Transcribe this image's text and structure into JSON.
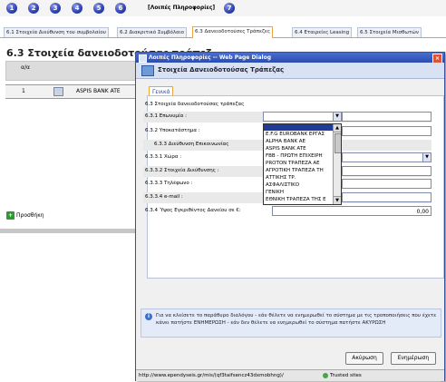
{
  "steps": [
    "1",
    "2",
    "3",
    "4",
    "5",
    "6",
    "7"
  ],
  "current_step_label": "[Λοιπές Πληροφορίες]",
  "tabs": [
    "6.1 Στοιχεία Διεύθυνση του συμβολαίου",
    "6.2 Διακριτικό Συμβόλαιο",
    "6.3 Δανειοδοτούσες Τράπεζες",
    "6.4 Εταιρείες Leasing",
    "6.5 Στοιχεία Μισθωτών"
  ],
  "section_title": "6.3 Στοιχεία δανειοδοτούσας τράπεζ",
  "grid": {
    "header": "α/α",
    "rows": [
      {
        "num": "1",
        "name": "ASPIS BANK ATE"
      }
    ]
  },
  "add_button": "Προσθήκη",
  "dialog": {
    "title": "Λοιπές Πληροφορίες -- Web Page Dialog",
    "header": "Στοιχεία Δανειοδοτούσας Τράπεζας",
    "inner_tab": "Γενικά",
    "form": {
      "group_label": "6.3 Στοιχεία δανειοδοτούσας τράπεζας",
      "f1": "6.3.1 Επωνυμία :",
      "f2": "6.3.2 Υποκατάστημα :",
      "f3": "6.3.3 Διεύθυνση Επικοινωνίας",
      "f4": "6.3.3.1 Χώρα :",
      "f5": "6.3.3.2 Στοιχεία Διεύθυνσης :",
      "f6": "6.3.3.3 Τηλέφωνο :",
      "f7": "6.3.3.4 e-mail :",
      "f8": "6.3.4 Ύψος Εγκριθέντος Δανείου σε €:",
      "amount": "0,00"
    },
    "dropdown_options": [
      "",
      "E.F.G EUROBANK ΕΡΓΑΣ",
      "ALPHA BANK AE",
      "ASPIS BANK ATE",
      "FBB - ΠΡΩΤΗ ΕΠΙΧΕΙΡΗ",
      "PROTON ΤΡΑΠΕΖΑ ΑΕ",
      "ΑΓΡΟΤΙΚΗ ΤΡΑΠΕΖΑ ΤΗ",
      "ΑΤΤΙΚΗΣ ΤΡ.",
      "ΑΣΦΑΛΙΣΤΙΚΟ",
      "ΓΕΝΙΚΗ",
      "ΕΘΝΙΚΗ ΤΡΑΠΕΖΑ ΤΗΣ Ε",
      "ΕΛΛΗΝΙΚΗ ΤΡΑΠΕΖΑ ΑΗ"
    ],
    "info_text": "Για να κλείσετε το παράθυρο διαλόγου - εάν θέλετε να ενημερωθεί το σύστημα με τις τροποποιήσεις που έχετε κάνει πατήστε ΕΝΗΜΕΡΩΣΗ - εάν δεν θέλετε να ενημερωθεί το σύστημα πατήστε ΑΚΥΡΩΣΗ",
    "cancel_label": "Ακύρωση",
    "update_label": "Ενημέρωση",
    "status_url": "http://www.ependyseis.gr/mis/(qf3taifsencz43dxmobhng)/",
    "status_zone": "Trusted sites"
  }
}
